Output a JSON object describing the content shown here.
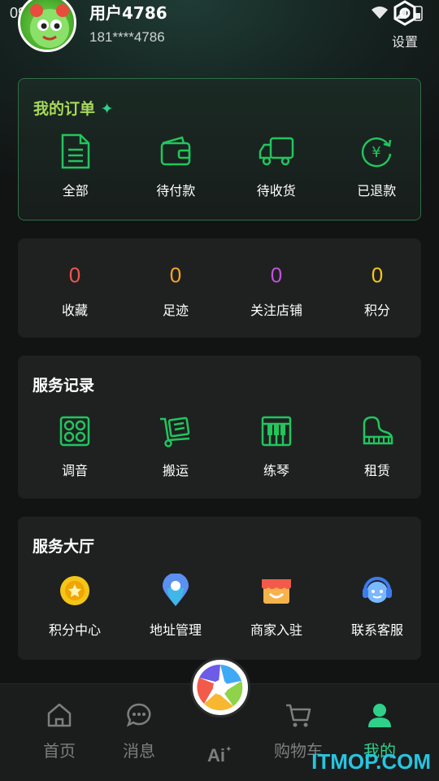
{
  "status_bar": {
    "time": "09:54"
  },
  "profile": {
    "username": "用户4786",
    "phone": "181****4786",
    "settings_label": "设置"
  },
  "orders": {
    "title": "我的订单",
    "items": [
      {
        "label": "全部",
        "icon": "document-icon"
      },
      {
        "label": "待付款",
        "icon": "wallet-icon"
      },
      {
        "label": "待收货",
        "icon": "truck-icon"
      },
      {
        "label": "已退款",
        "icon": "refund-icon"
      }
    ]
  },
  "stats": [
    {
      "value": "0",
      "label": "收藏",
      "color": "#f0564e"
    },
    {
      "value": "0",
      "label": "足迹",
      "color": "#f5a623"
    },
    {
      "value": "0",
      "label": "关注店铺",
      "color": "#c34fe0"
    },
    {
      "value": "0",
      "label": "积分",
      "color": "#f5c518"
    }
  ],
  "service_records": {
    "title": "服务记录",
    "items": [
      {
        "label": "调音",
        "icon": "tuning-icon"
      },
      {
        "label": "搬运",
        "icon": "moving-cart-icon"
      },
      {
        "label": "练琴",
        "icon": "piano-keys-icon"
      },
      {
        "label": "租赁",
        "icon": "grand-piano-icon"
      }
    ]
  },
  "service_hall": {
    "title": "服务大厅",
    "items": [
      {
        "label": "积分中心",
        "icon": "points-coin-icon"
      },
      {
        "label": "地址管理",
        "icon": "location-pin-icon"
      },
      {
        "label": "商家入驻",
        "icon": "shop-icon"
      },
      {
        "label": "联系客服",
        "icon": "customer-service-icon"
      }
    ]
  },
  "tabbar": [
    {
      "label": "首页",
      "icon": "home-icon"
    },
    {
      "label": "消息",
      "icon": "message-icon"
    },
    {
      "label": "",
      "icon": "ai-icon"
    },
    {
      "label": "购物车",
      "icon": "cart-icon"
    },
    {
      "label": "我的",
      "icon": "profile-icon",
      "active": true
    }
  ],
  "watermark": "ITMOP.COM",
  "colors": {
    "accent_green": "#2fd18a",
    "icon_green": "#22c55e",
    "order_title": "#a8d85a"
  }
}
